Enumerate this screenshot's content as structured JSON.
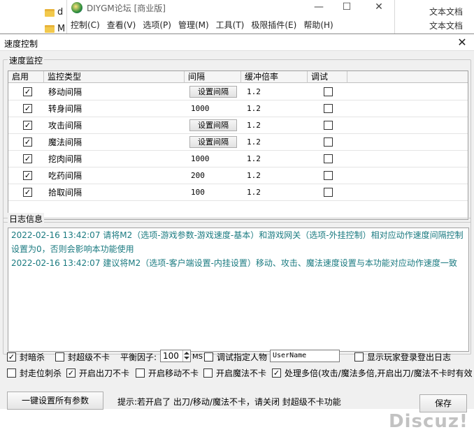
{
  "background": {
    "folder_partial_1": "d",
    "folder_partial_2": "M",
    "right_labels": [
      "文本文档",
      "文本文档"
    ],
    "app_title": "DIYGM论坛 [商业版]",
    "menu": [
      "控制(C)",
      "查看(V)",
      "选项(P)",
      "管理(M)",
      "工具(T)",
      "极限插件(E)",
      "帮助(H)"
    ]
  },
  "dialog": {
    "title": "速度控制",
    "close_label": "✕"
  },
  "speed_group": {
    "legend": "速度监控",
    "columns": [
      "启用",
      "监控类型",
      "间隔",
      "缓冲倍率",
      "调试"
    ],
    "rows": [
      {
        "enabled": true,
        "type": "移动间隔",
        "interval": "设置间隔",
        "interval_is_button": true,
        "ratio": "1.2",
        "debug": false
      },
      {
        "enabled": true,
        "type": "转身间隔",
        "interval": "1000",
        "interval_is_button": false,
        "ratio": "1.2",
        "debug": false
      },
      {
        "enabled": true,
        "type": "攻击间隔",
        "interval": "设置间隔",
        "interval_is_button": true,
        "ratio": "1.2",
        "debug": false
      },
      {
        "enabled": true,
        "type": "魔法间隔",
        "interval": "设置间隔",
        "interval_is_button": true,
        "ratio": "1.2",
        "debug": false
      },
      {
        "enabled": true,
        "type": "挖肉间隔",
        "interval": "1000",
        "interval_is_button": false,
        "ratio": "1.2",
        "debug": false
      },
      {
        "enabled": true,
        "type": "吃药间隔",
        "interval": "200",
        "interval_is_button": false,
        "ratio": "1.2",
        "debug": false
      },
      {
        "enabled": true,
        "type": "拾取间隔",
        "interval": "100",
        "interval_is_button": false,
        "ratio": "1.2",
        "debug": false
      }
    ]
  },
  "log_group": {
    "legend": "日志信息",
    "lines": [
      "2022-02-16 13:42:07 请将M2（选项-游戏参数-游戏速度-基本）和游戏网关（选项-外挂控制）相对应动作速度间隔控制设置为0，否则会影响本功能使用",
      "2022-02-16 13:42:07 建议将M2（选项-客户端设置-内挂设置）移动、攻击、魔法速度设置与本功能对应动作速度一致"
    ]
  },
  "options": {
    "feng_an_sha": {
      "label": "封暗杀",
      "checked": true
    },
    "feng_chao_ji_bu_ka": {
      "label": "封超级不卡",
      "checked": false
    },
    "balance_label": "平衡因子:",
    "balance_value": "100",
    "balance_unit": "MS",
    "debug_player": {
      "label": "调试指定人物",
      "checked": false
    },
    "debug_player_value": "UserName",
    "show_login_log": {
      "label": "显示玩家登录登出日志",
      "checked": false
    },
    "feng_zou_wei": {
      "label": "封走位刺杀",
      "checked": false
    },
    "chu_dao": {
      "label": "开启出刀不卡",
      "checked": true
    },
    "yi_dong": {
      "label": "开启移动不卡",
      "checked": false
    },
    "mo_fa": {
      "label": "开启魔法不卡",
      "checked": false
    },
    "duo_bei": {
      "label": "处理多倍(攻击/魔法多倍,开启出刀/魔法不卡时有效",
      "checked": true
    }
  },
  "footer": {
    "set_all_button": "一键设置所有参数",
    "hint": "提示:若开启了 出刀/移动/魔法不卡，请关闭 封超级不卡功能",
    "save_button": "保存",
    "watermark": "Discuz!"
  }
}
